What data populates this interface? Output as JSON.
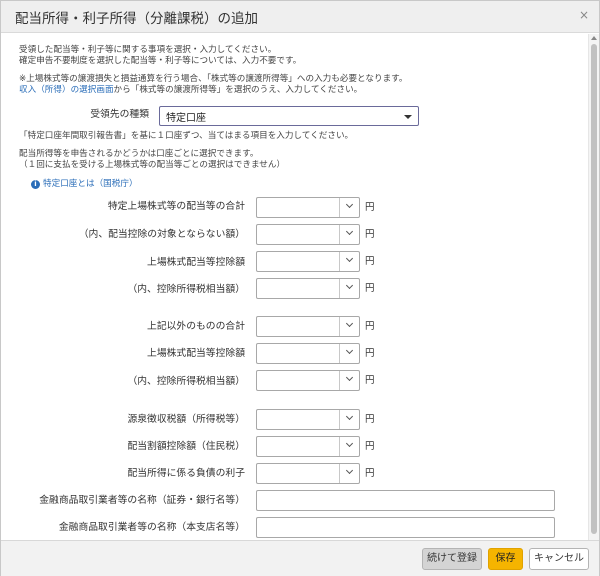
{
  "dialog": {
    "title": "配当所得・利子所得（分離課税）の追加",
    "close_glyph": "×"
  },
  "intro": {
    "line1": "受領した配当等・利子等に関する事項を選択・入力してください。",
    "line2": "確定申告不要制度を選択した配当等・利子等については、入力不要です。",
    "note1": "※上場株式等の譲渡損失と損益通算を行う場合、「株式等の譲渡所得等」への入力も必要となります。",
    "note2_link": "収入（所得）の選択画面",
    "note2_rest": "から「株式等の譲渡所得等」を選択のうえ、入力してください。"
  },
  "account_type": {
    "label": "受領先の種類",
    "selected": "特定口座"
  },
  "guidance": {
    "line1": "「特定口座年間取引報告書」を基に１口座ずつ、当てはまる項目を入力してください。",
    "line2": "配当所得等を申告されるかどうかは口座ごとに選択できます。",
    "line3": "（１回に支払を受ける上場株式等の配当等ごとの選択はできません）"
  },
  "help_link": {
    "icon": "i",
    "text": "特定口座とは（国税庁）"
  },
  "yen_unit": "円",
  "fields": {
    "listed_total": "特定上場株式等の配当等の合計",
    "listed_not_eligible": "（内、配当控除の対象とならない額）",
    "listed_dividend_deduction": "上場株式配当等控除額",
    "listed_tax_equivalent": "（内、控除所得税相当額）",
    "other_total": "上記以外のものの合計",
    "other_dividend_deduction": "上場株式配当等控除額",
    "other_tax_equivalent": "（内、控除所得税相当額）",
    "withholding_tax": "源泉徴収税額（所得税等）",
    "dividend_deduction_resident": "配当割額控除額（住民税）",
    "debt_interest": "配当所得に係る負債の利子",
    "institution_name": "金融商品取引業者等の名称（証券・銀行名等）",
    "branch_name": "金融商品取引業者等の名称（本支店名等）"
  },
  "footer": {
    "continue_label": "続けて登録",
    "save_label": "保存",
    "cancel_label": "キャンセル"
  }
}
